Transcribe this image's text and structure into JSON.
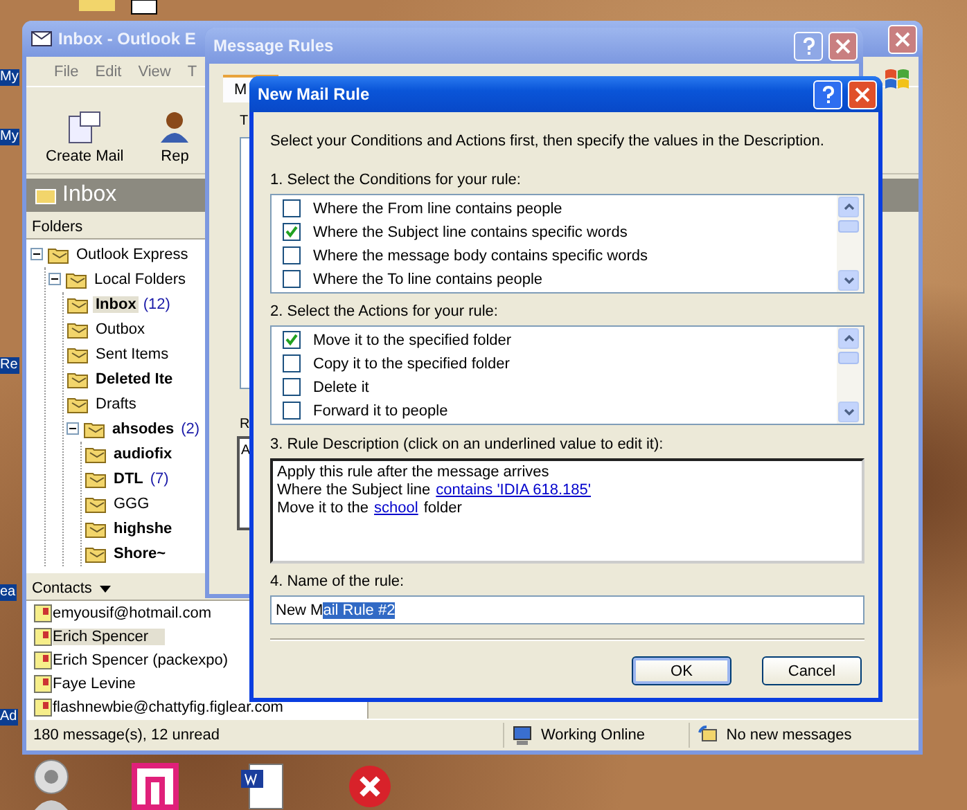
{
  "desktop": {
    "icon_labels": [
      "My",
      "My",
      "Re",
      "ea",
      "Ad"
    ]
  },
  "outlook": {
    "title": "Inbox - Outlook E",
    "menu": [
      "File",
      "Edit",
      "View",
      "T"
    ],
    "toolbar": [
      "Create Mail",
      "Rep"
    ],
    "header": "Inbox",
    "folders_label": "Folders",
    "folders": [
      {
        "label": "Outlook Express",
        "unread": false,
        "selected": false,
        "expanded": true,
        "children": [
          {
            "label": "Local Folders",
            "unread": false,
            "selected": false,
            "expanded": true,
            "children": [
              {
                "label": "Inbox",
                "count": "(12)",
                "unread": true,
                "selected": true
              },
              {
                "label": "Outbox",
                "unread": false,
                "selected": false
              },
              {
                "label": "Sent Items",
                "unread": false,
                "selected": false
              },
              {
                "label": "Deleted Ite",
                "unread": true,
                "selected": false
              },
              {
                "label": "Drafts",
                "unread": false,
                "selected": false
              },
              {
                "label": "ahsodes",
                "count": "(2)",
                "unread": true,
                "selected": false,
                "expanded": true,
                "children": [
                  {
                    "label": "audiofix",
                    "unread": true,
                    "selected": false
                  },
                  {
                    "label": "DTL",
                    "count": "(7)",
                    "unread": true,
                    "selected": false
                  },
                  {
                    "label": "GGG",
                    "unread": false,
                    "selected": false
                  },
                  {
                    "label": "highshe",
                    "unread": true,
                    "selected": false
                  },
                  {
                    "label": "Shore~",
                    "unread": true,
                    "selected": false
                  }
                ]
              }
            ]
          }
        ]
      }
    ],
    "contacts_label": "Contacts",
    "contacts": [
      {
        "name": "emyousif@hotmail.com",
        "selected": false
      },
      {
        "name": "Erich Spencer",
        "selected": true
      },
      {
        "name": "Erich Spencer (packexpo)",
        "selected": false
      },
      {
        "name": "Faye Levine",
        "selected": false
      },
      {
        "name": "flashnewbie@chattyfig.figlear.com",
        "selected": false
      }
    ],
    "status_bar": [
      "180 message(s), 12 unread",
      "Working Online",
      "No new messages"
    ]
  },
  "message_rules": {
    "title": "Message Rules",
    "tab": "M",
    "fragments": [
      "T",
      "R"
    ],
    "desc_fragments": [
      "A"
    ]
  },
  "new_mail_rule": {
    "title": "New Mail Rule",
    "intro": "Select your Conditions and Actions first, then specify the values in the Description.",
    "conditions_label": "1. Select the Conditions for your rule:",
    "conditions": [
      {
        "label": "Where the From line contains people",
        "checked": false
      },
      {
        "label": "Where the Subject line contains specific words",
        "checked": true
      },
      {
        "label": "Where the message body contains specific words",
        "checked": false
      },
      {
        "label": "Where the To line contains people",
        "checked": false
      }
    ],
    "actions_label": "2. Select the Actions for your rule:",
    "actions": [
      {
        "label": "Move it to the specified folder",
        "checked": true
      },
      {
        "label": "Copy it to the specified folder",
        "checked": false
      },
      {
        "label": "Delete it",
        "checked": false
      },
      {
        "label": "Forward it to people",
        "checked": false
      }
    ],
    "description_label": "3. Rule Description (click on an underlined value to edit it):",
    "description": [
      [
        {
          "kind": "text",
          "text": "Apply this rule after the message arrives"
        }
      ],
      [
        {
          "kind": "text",
          "text": "Where the Subject line"
        },
        {
          "kind": "link",
          "text": "contains 'IDIA 618.185'"
        }
      ],
      [
        {
          "kind": "text",
          "text": "Move it to the"
        },
        {
          "kind": "link",
          "text": "school"
        },
        {
          "kind": "text",
          "text": "folder"
        }
      ]
    ],
    "name_label": "4. Name of the rule:",
    "name_value_unselected": "New M",
    "name_value_selected": "ail Rule #2",
    "buttons": [
      {
        "label": "OK",
        "default": true
      },
      {
        "label": "Cancel",
        "default": false
      }
    ]
  }
}
